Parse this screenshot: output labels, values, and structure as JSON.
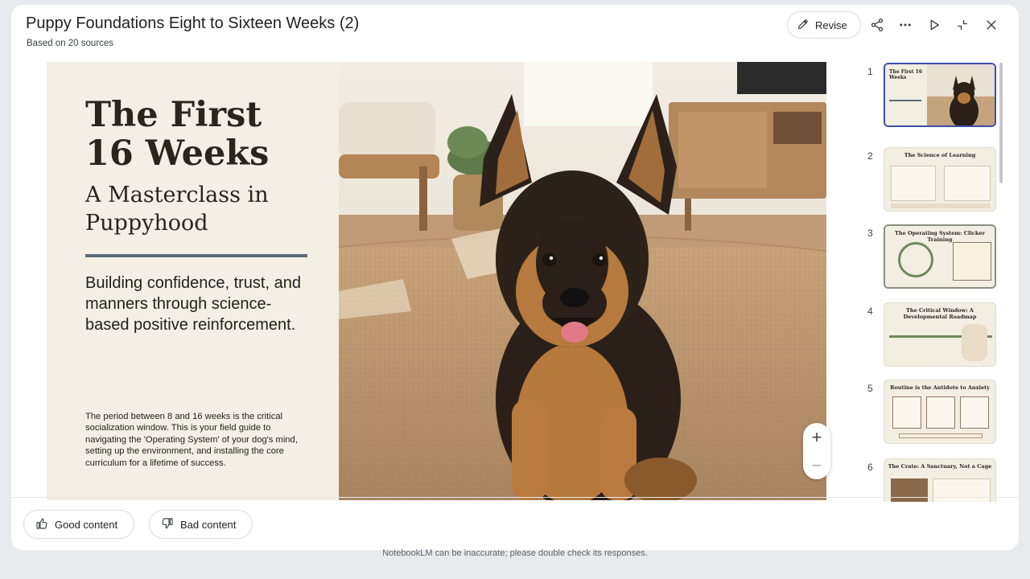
{
  "header": {
    "title": "Puppy Foundations Eight to Sixteen Weeks (2)",
    "subtitle": "Based on 20 sources",
    "revise_label": "Revise",
    "icons": [
      "pencil-icon",
      "share-icon",
      "more-icon",
      "play-icon",
      "collapse-icon",
      "close-icon"
    ]
  },
  "slide": {
    "title_line1": "The First",
    "title_line2": "16 Weeks",
    "subtitle_line1": "A Masterclass in",
    "subtitle_line2": "Puppyhood",
    "lead": "Building confidence, trust, and manners through science-based positive reinforcement.",
    "body": "The period between 8 and 16 weeks is the critical socialization window. This is your field guide to navigating the 'Operating System' of your dog's mind, setting up the environment, and installing the core curriculum for a lifetime of success.",
    "image": "german-shepherd-puppy-photo"
  },
  "zoom": {
    "plus": "+",
    "minus": "−"
  },
  "thumbnails": [
    {
      "number": "1",
      "title": "The First 16 Weeks",
      "state": "selected"
    },
    {
      "number": "2",
      "title": "The Science of Learning",
      "state": "normal"
    },
    {
      "number": "3",
      "title": "The Operating System: Clicker Training",
      "state": "hover"
    },
    {
      "number": "4",
      "title": "The Critical Window: A Developmental Roadmap",
      "state": "normal"
    },
    {
      "number": "5",
      "title": "Routine is the Antidote to Anxiety",
      "state": "normal"
    },
    {
      "number": "6",
      "title": "The Crate: A Sanctuary, Not a Cage",
      "state": "normal"
    }
  ],
  "feedback": {
    "good_label": "Good content",
    "bad_label": "Bad content"
  },
  "disclaimer": "NotebookLM can be inaccurate; please double check its responses.",
  "colors": {
    "slide_bg": "#f4efe4",
    "accent_rule": "#5a6b78",
    "selected_border": "#3c4fa8"
  }
}
